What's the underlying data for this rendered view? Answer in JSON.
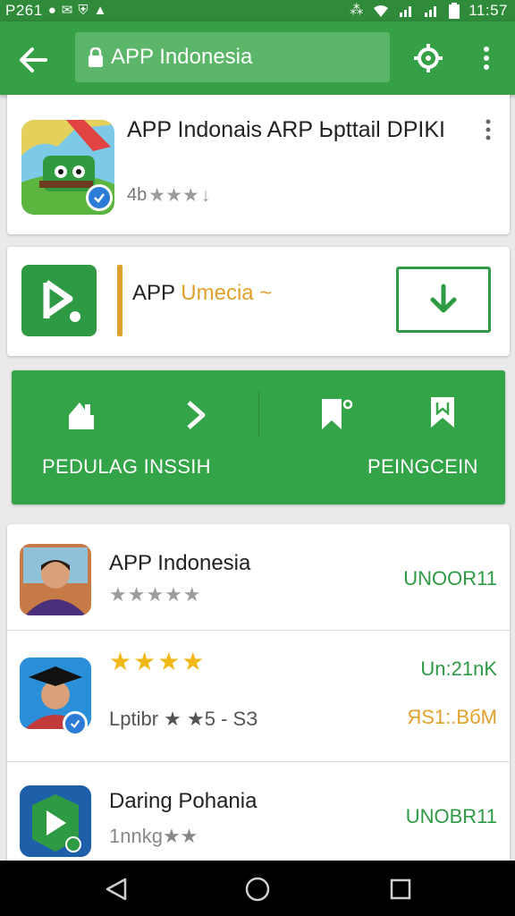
{
  "status_bar": {
    "left_text": "P261",
    "left_icons": [
      "notification-icon",
      "mail-icon",
      "shield-icon",
      "android-icon"
    ],
    "right_icons": [
      "bluetooth-icon",
      "wifi-icon",
      "signal-icon",
      "signal-icon",
      "battery-icon"
    ],
    "time": "11:57"
  },
  "app_bar": {
    "search_text": "APP Indonesia",
    "colors": {
      "bar": "#36a047",
      "search_bg": "#5cb66a"
    }
  },
  "top_card": {
    "title": "APP Indonais ARP Ьpttail DPIKI",
    "rating_prefix": "4b",
    "rating_stars": "★★★",
    "rating_suffix": "↓"
  },
  "install_card": {
    "label_main": "APP",
    "label_accent": "Umecia",
    "label_tail": "~"
  },
  "actions": {
    "left_label": "PEDULAG INSSIH",
    "right_label": "PEINGCEIN",
    "icons": [
      "home-icon",
      "chevron-right-icon",
      "bookmark-plus-icon",
      "bookmark-icon"
    ]
  },
  "list": {
    "items": [
      {
        "title": "APP Indonesia",
        "stars": "★★★★★",
        "price": "UNOOR11"
      },
      {
        "stars": "★★★★",
        "meta": "Lptibr ★ ★5 - ЅЗ",
        "price": "Un:21nK",
        "price2": "ЯЅ1:.ВбМ"
      },
      {
        "title": "Daring Pohania",
        "meta": "1nnkg★★",
        "price": "UNOBR11"
      }
    ]
  },
  "colors": {
    "accent_green": "#2e9a44",
    "accent_orange": "#e2a12c",
    "star_gold": "#f2b818"
  }
}
